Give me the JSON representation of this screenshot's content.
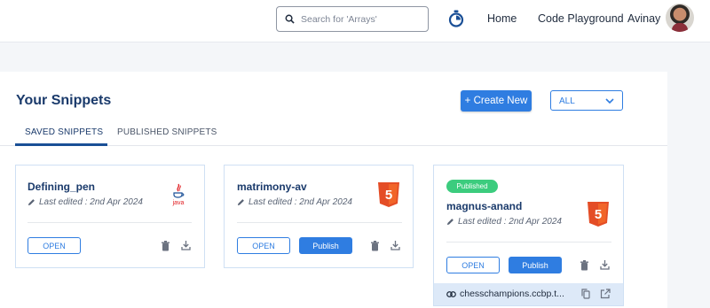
{
  "header": {
    "search_placeholder": "Search for 'Arrays'",
    "nav_home": "Home",
    "nav_playground": "Code Playground",
    "user_name": "Avinay"
  },
  "page": {
    "title": "Your Snippets",
    "create_label": "+ Create New",
    "filter_value": "ALL",
    "tabs": [
      "SAVED SNIPPETS",
      "PUBLISHED SNIPPETS"
    ],
    "active_tab": "SAVED SNIPPETS"
  },
  "snippets": [
    {
      "name": "Defining_pen",
      "edited": "Last edited : 2nd Apr 2024",
      "language_icon": "java-icon",
      "language_label": "java",
      "open_label": "OPEN",
      "published": false
    },
    {
      "name": "matrimony-av",
      "edited": "Last edited : 2nd Apr 2024",
      "language_icon": "html5-icon",
      "language_label": "5",
      "open_label": "OPEN",
      "publish_label": "Publish",
      "published": false
    },
    {
      "name": "magnus-anand",
      "edited": "Last edited : 2nd Apr 2024",
      "language_icon": "html5-icon",
      "language_label": "5",
      "open_label": "OPEN",
      "publish_label": "Publish",
      "published": true,
      "badge": "Published",
      "link": "chesschampions.ccbp.t..."
    }
  ],
  "colors": {
    "primary": "#2f7de1",
    "title": "#1a3a6b",
    "published_badge": "#3ccc7e",
    "html5": "#e44d26",
    "java": "#e11e22"
  }
}
